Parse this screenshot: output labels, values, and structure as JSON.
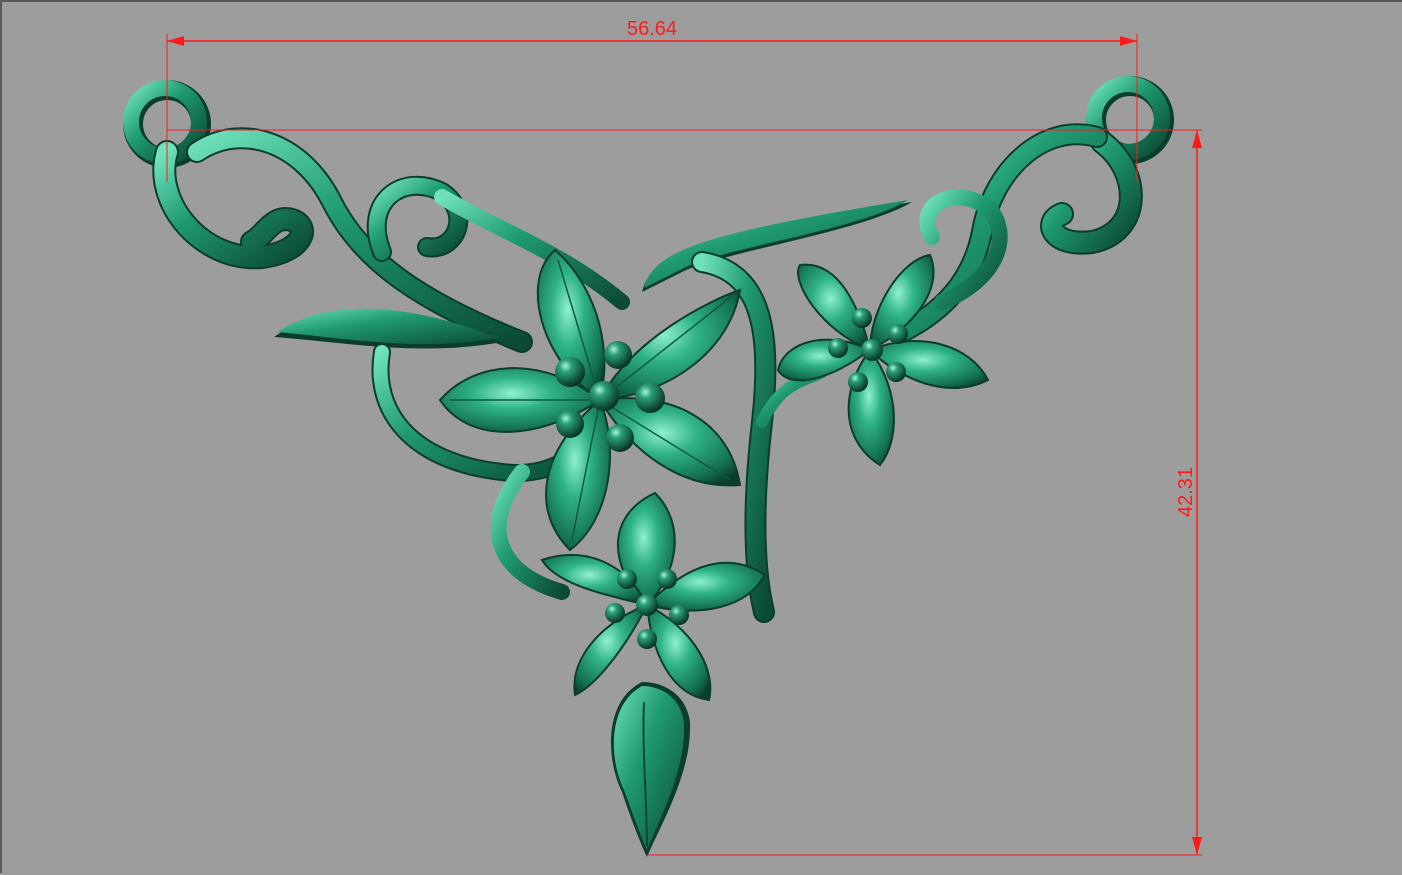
{
  "viewport": {
    "background": "#9d9d9d"
  },
  "model": {
    "material_color": "#1a8a66",
    "highlight_color": "#7fe8c6",
    "shadow_color": "#0b3d2c"
  },
  "dimensions": {
    "color": "#ff1a1a",
    "width": {
      "value": "56.64"
    },
    "height": {
      "value": "42.31"
    }
  }
}
